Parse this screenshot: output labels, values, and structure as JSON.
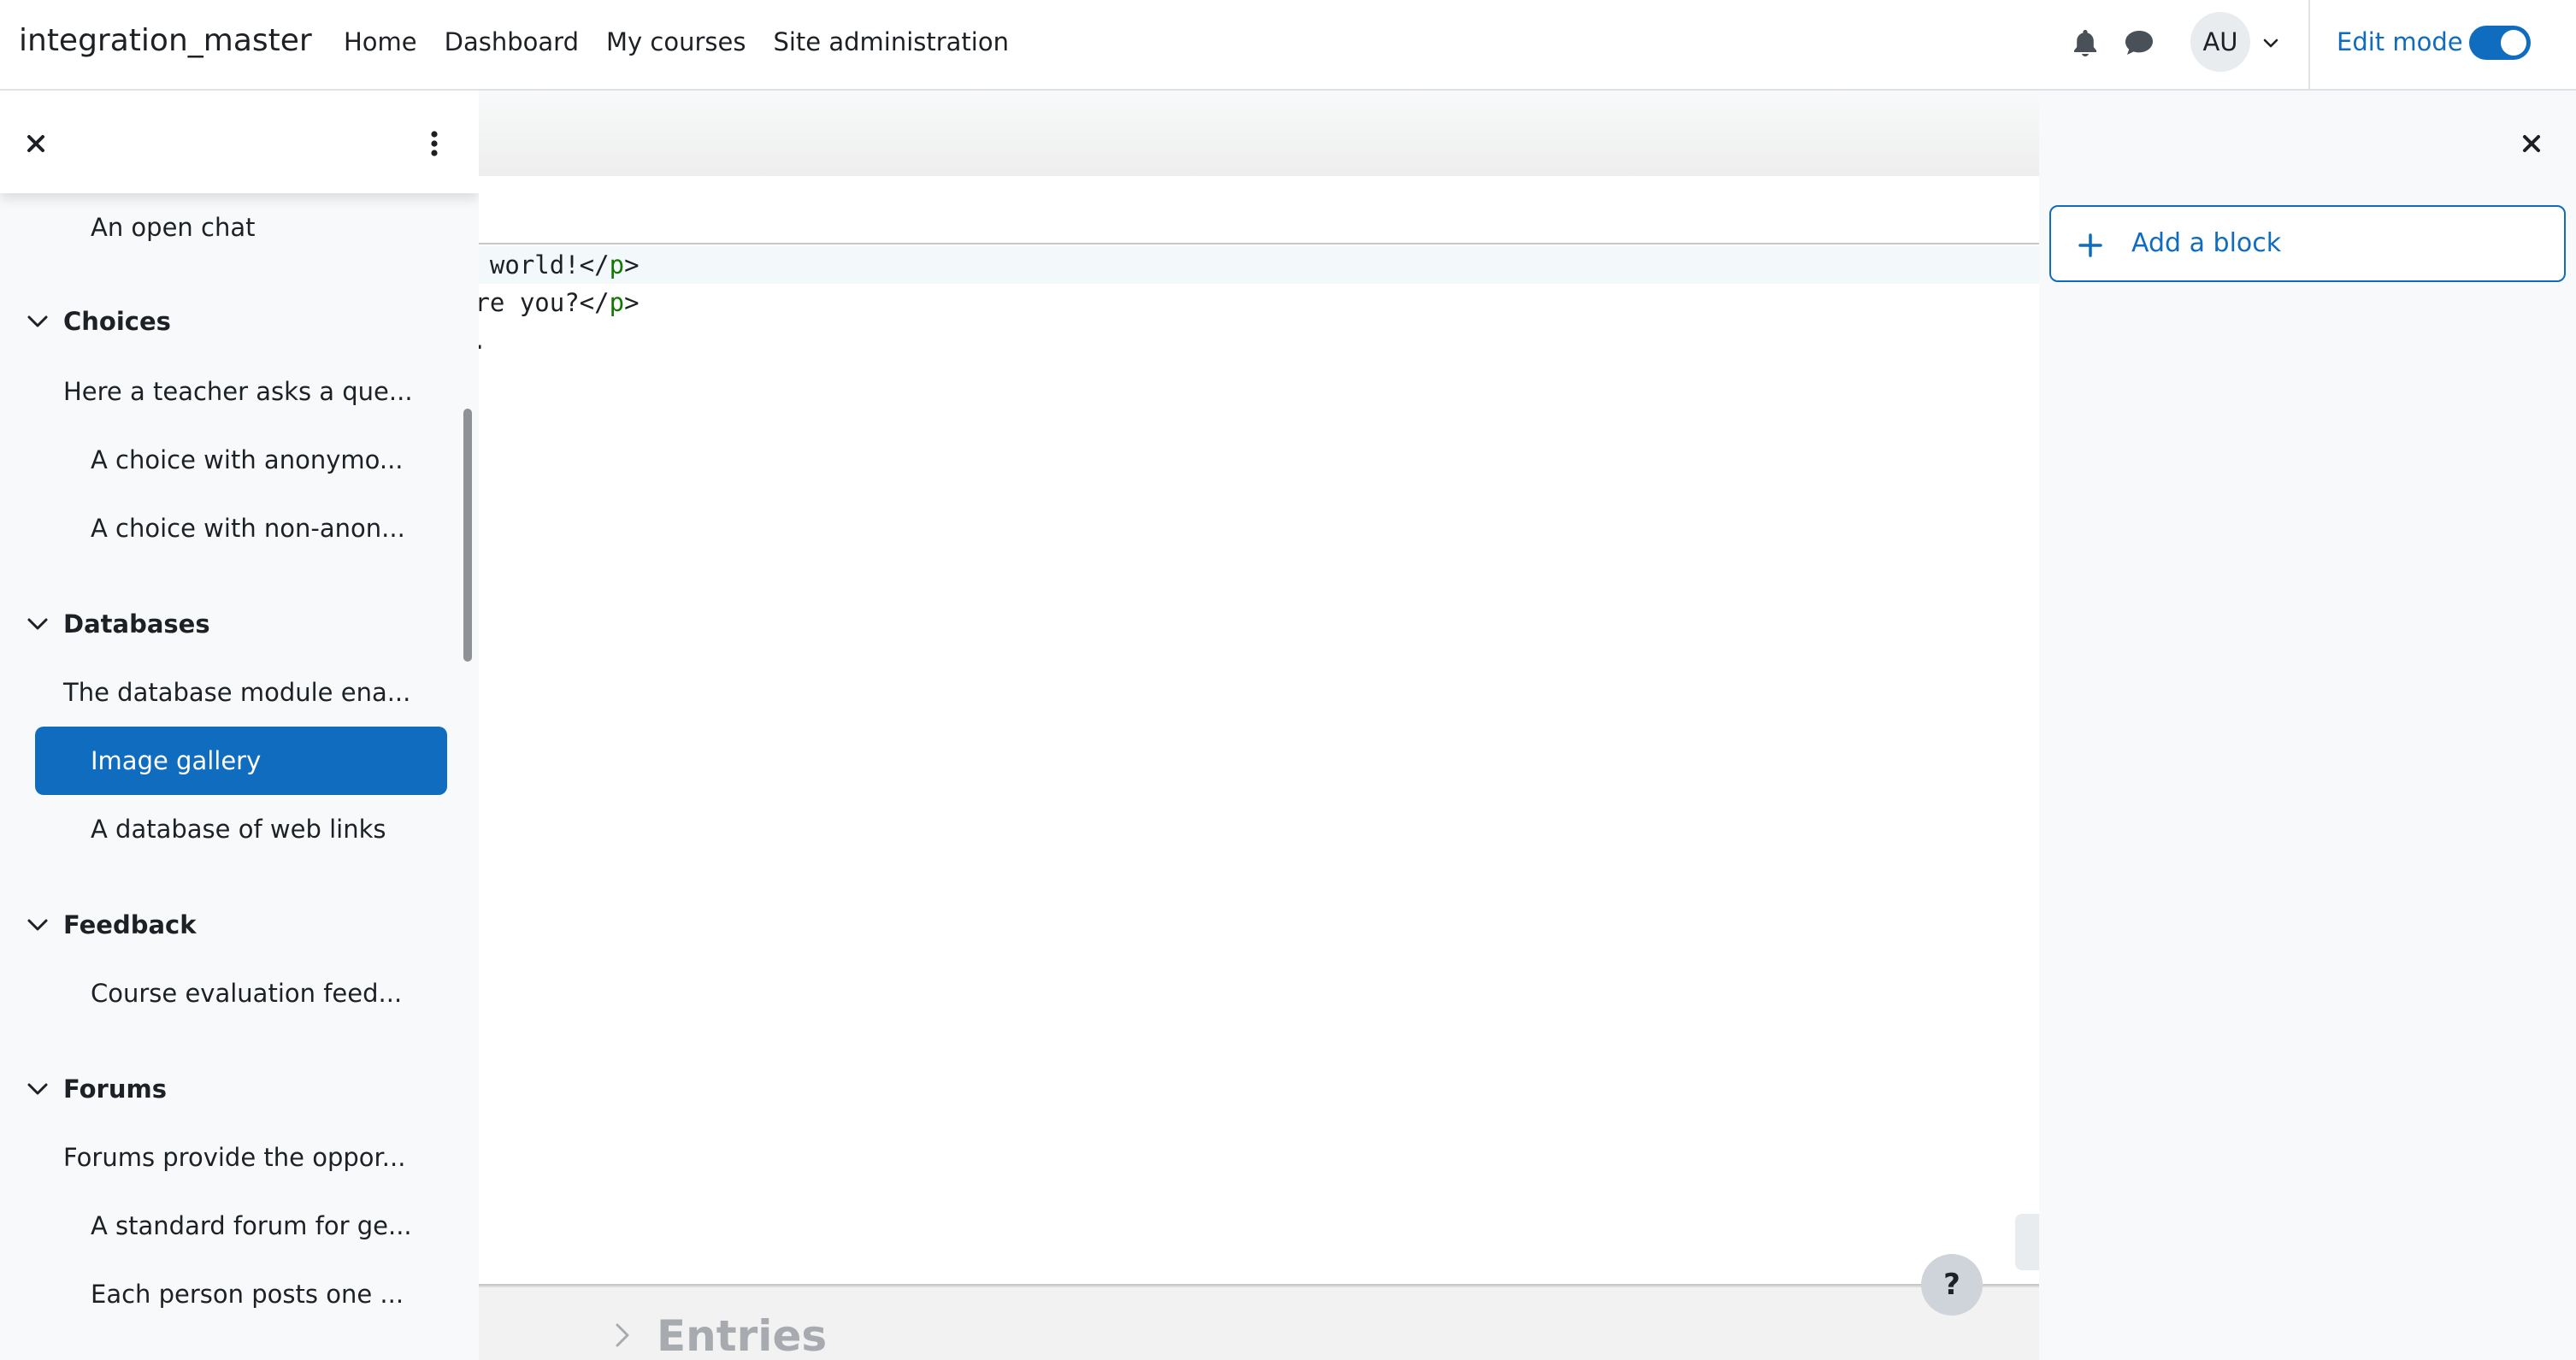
{
  "navbar": {
    "site_name": "integration_master",
    "links": [
      "Home",
      "Dashboard",
      "My courses",
      "Site administration"
    ],
    "user_initials": "AU",
    "edit_mode_label": "Edit mode",
    "edit_mode_on": true,
    "icons": [
      "bell-icon",
      "chat-icon",
      "chevron-down-icon"
    ]
  },
  "course_index": {
    "items": [
      {
        "type": "item",
        "level": 1,
        "label": "An open chat"
      },
      {
        "type": "section",
        "label": "Choices"
      },
      {
        "type": "item",
        "level": 0,
        "label": "Here a teacher asks a que..."
      },
      {
        "type": "item",
        "level": 1,
        "label": "A choice with anonymo..."
      },
      {
        "type": "item",
        "level": 1,
        "label": "A choice with non-anon..."
      },
      {
        "type": "section",
        "label": "Databases"
      },
      {
        "type": "item",
        "level": 0,
        "label": "The database module ena..."
      },
      {
        "type": "item",
        "level": 1,
        "label": "Image gallery",
        "active": true
      },
      {
        "type": "item",
        "level": 1,
        "label": "A database of web links"
      },
      {
        "type": "section",
        "label": "Feedback"
      },
      {
        "type": "item",
        "level": 1,
        "label": "Course evaluation feed..."
      },
      {
        "type": "section",
        "label": "Forums"
      },
      {
        "type": "item",
        "level": 0,
        "label": "Forums provide the oppor..."
      },
      {
        "type": "item",
        "level": 1,
        "label": "A standard forum for ge..."
      },
      {
        "type": "item",
        "level": 1,
        "label": "Each person posts one ..."
      }
    ]
  },
  "editor": {
    "line1_text": "o world!</",
    "line1_tag": "p",
    "line1_end": ">",
    "line2_text": "are you?</",
    "line2_tag": "p",
    "line2_end": ">",
    "line3_text": "."
  },
  "main": {
    "entries_heading": "Entries",
    "help_label": "?"
  },
  "blocks_drawer": {
    "add_block_label": "Add a block"
  },
  "colors": {
    "accent": "#0f6cbf",
    "drawer_bg": "#f8f9fa",
    "code_tag": "#117700"
  }
}
